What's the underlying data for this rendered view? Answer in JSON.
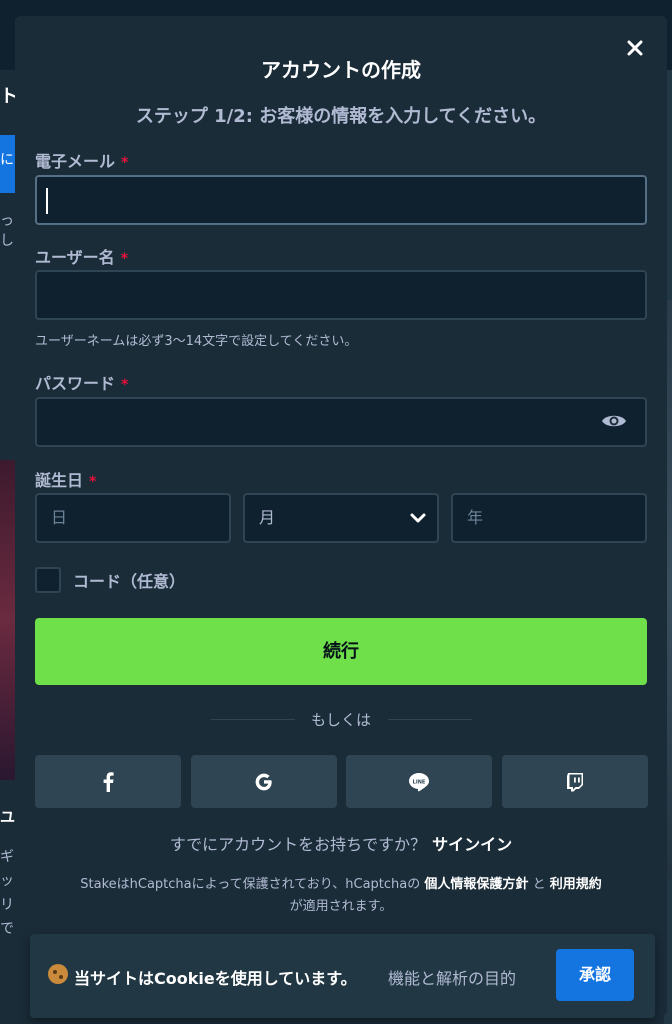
{
  "background": {
    "left_glyphs": [
      "ト",
      "に",
      "っし",
      "ユ",
      "ギ",
      "ッ",
      "リ",
      "で"
    ]
  },
  "modal": {
    "title": "アカウントの作成",
    "close_icon": "close-icon",
    "step": "ステップ 1/2: お客様の情報を入力してください。"
  },
  "form": {
    "email_label": "電子メール",
    "username_label": "ユーザー名",
    "username_hint": "ユーザーネームは必ず3〜14文字で設定してください。",
    "password_label": "パスワード",
    "password_toggle_icon": "eye-icon",
    "dob_label": "誕生日",
    "dob_day_placeholder": "日",
    "dob_month_placeholder": "月",
    "dob_year_placeholder": "年",
    "required_mark": "*",
    "code_label": "コード（任意）",
    "continue_label": "続行",
    "or_label": "もしくは"
  },
  "social": [
    {
      "name": "facebook",
      "icon": "facebook-icon"
    },
    {
      "name": "google",
      "icon": "google-icon"
    },
    {
      "name": "line",
      "icon": "line-icon",
      "text": "LINE"
    },
    {
      "name": "twitch",
      "icon": "twitch-icon"
    }
  ],
  "signin": {
    "prompt": "すでにアカウントをお持ちですか？",
    "link": "サインイン"
  },
  "legal": {
    "prefix": "StakeはhCaptchaによって保護されており、hCaptchaの",
    "privacy": "個人情報保護方針",
    "and": "と",
    "terms": "利用規約",
    "suffix": "が適用されます。"
  },
  "cookie": {
    "icon": "cookie-icon",
    "text": "当サイトはCookieを使用しています。",
    "link": "機能と解析の目的",
    "accept": "承認"
  },
  "colors": {
    "accent_green": "#6fe04a",
    "accent_blue": "#1475e1",
    "required_red": "#e9113c",
    "modal_bg": "#1a2c38",
    "input_bg": "#0f212e"
  }
}
